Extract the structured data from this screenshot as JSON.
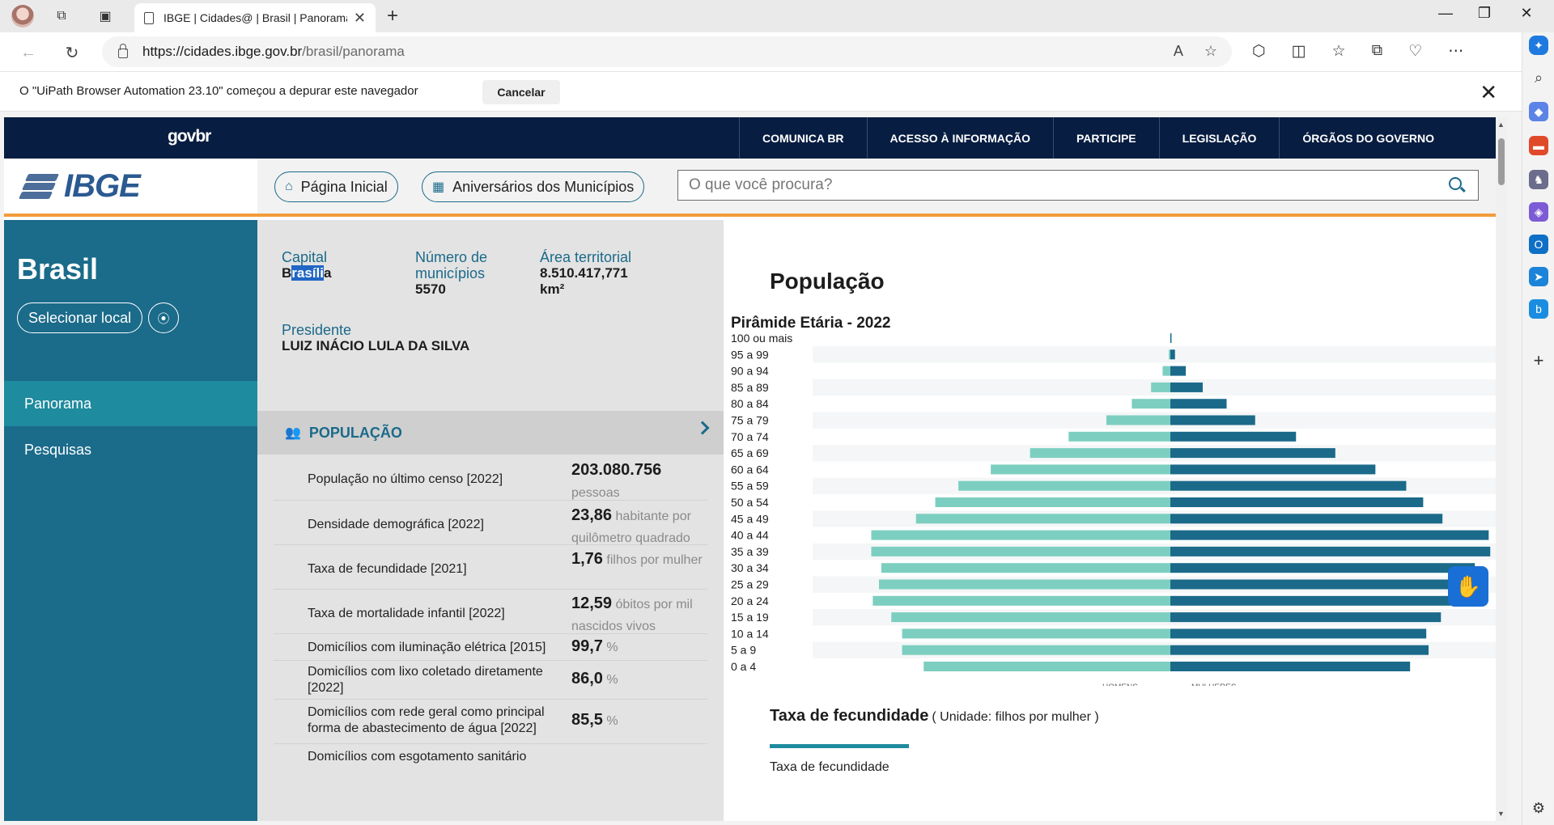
{
  "browser": {
    "tab_title": "IBGE | Cidades@ | Brasil | Panorama",
    "url_host": "https://cidades.ibge.gov.br",
    "url_path": "/brasil/panorama",
    "infobar_text": "O \"UiPath Browser Automation 23.10\" começou a depurar este navegador",
    "infobar_cancel": "Cancelar"
  },
  "gov": {
    "logo_left": "gov",
    "logo_right": "br",
    "links": [
      "COMUNICA BR",
      "ACESSO À INFORMAÇÃO",
      "PARTICIPE",
      "LEGISLAÇÃO",
      "ÓRGÃOS DO GOVERNO"
    ]
  },
  "header": {
    "logo": "IBGE",
    "home_label": "Página Inicial",
    "anniv_label": "Aniversários dos Municípios",
    "search_placeholder": "O que você procura?"
  },
  "leftnav": {
    "title": "Brasil",
    "select_label": "Selecionar local",
    "items": [
      "Panorama",
      "Pesquisas"
    ]
  },
  "facts": {
    "capital_label": "Capital",
    "capital_value_pre": "B",
    "capital_value_sel": "rasíli",
    "capital_value_post": "a",
    "municipios_label": "Número de municípios",
    "municipios_value": "5570",
    "area_label": "Área territorial",
    "area_value": "8.510.417,771 km²",
    "presidente_label": "Presidente",
    "presidente_value": "LUIZ INÁCIO LULA DA SILVA"
  },
  "population_section": {
    "title": "POPULAÇÃO",
    "rows": [
      {
        "label": "População no último censo [2022]",
        "value": "203.080.756",
        "unit": "pessoas"
      },
      {
        "label": "Densidade demográfica [2022]",
        "value": "23,86",
        "unit": "habitante por quilômetro quadrado"
      },
      {
        "label": "Taxa de fecundidade [2021]",
        "value": "1,76",
        "unit": "filhos por mulher"
      },
      {
        "label": "Taxa de mortalidade infantil [2022]",
        "value": "12,59",
        "unit": "óbitos por mil nascidos vivos"
      },
      {
        "label": "Domicílios com iluminação elétrica [2015]",
        "value": "99,7",
        "unit": "%"
      },
      {
        "label": "Domicílios com lixo coletado diretamente [2022]",
        "value": "86,0",
        "unit": "%"
      },
      {
        "label": "Domicílios com rede geral como principal forma de abastecimento de água [2022]",
        "value": "85,5",
        "unit": "%"
      },
      {
        "label": "Domicílios com esgotamento sanitário",
        "value": "",
        "unit": ""
      }
    ]
  },
  "panel": {
    "title": "População",
    "chart_title": "Pirâmide Etária - 2022",
    "fecundidade_title": "Taxa de fecundidade",
    "fecundidade_unit": "( Unidade: filhos por mulher )",
    "fecundidade_legend": "Taxa de fecundidade"
  },
  "chart_data": {
    "type": "bar",
    "orientation": "horizontal-pyramid",
    "title": "Pirâmide Etária - 2022",
    "categories": [
      "100 ou mais",
      "95 a 99",
      "90 a 94",
      "85 a 89",
      "80 a 84",
      "75 a 79",
      "70 a 74",
      "65 a 69",
      "60 a 64",
      "55 a 59",
      "50 a 54",
      "45 a 49",
      "40 a 44",
      "35 a 39",
      "30 a 34",
      "25 a 29",
      "20 a 24",
      "15 a 19",
      "10 a 14",
      "5 a 9",
      "0 a 4"
    ],
    "series": [
      {
        "name": "HOMENS",
        "color": "#7ccfc0",
        "values": [
          0.3,
          2,
          10,
          25,
          50,
          83,
          132,
          182,
          233,
          275,
          305,
          330,
          388,
          388,
          375,
          378,
          386,
          362,
          348,
          348,
          320
        ]
      },
      {
        "name": "MULHERES",
        "color": "#1b6a8a",
        "values": [
          1.5,
          6,
          20,
          42,
          73,
          110,
          163,
          214,
          266,
          306,
          328,
          353,
          413,
          415,
          395,
          390,
          384,
          351,
          332,
          335,
          311
        ]
      }
    ]
  }
}
